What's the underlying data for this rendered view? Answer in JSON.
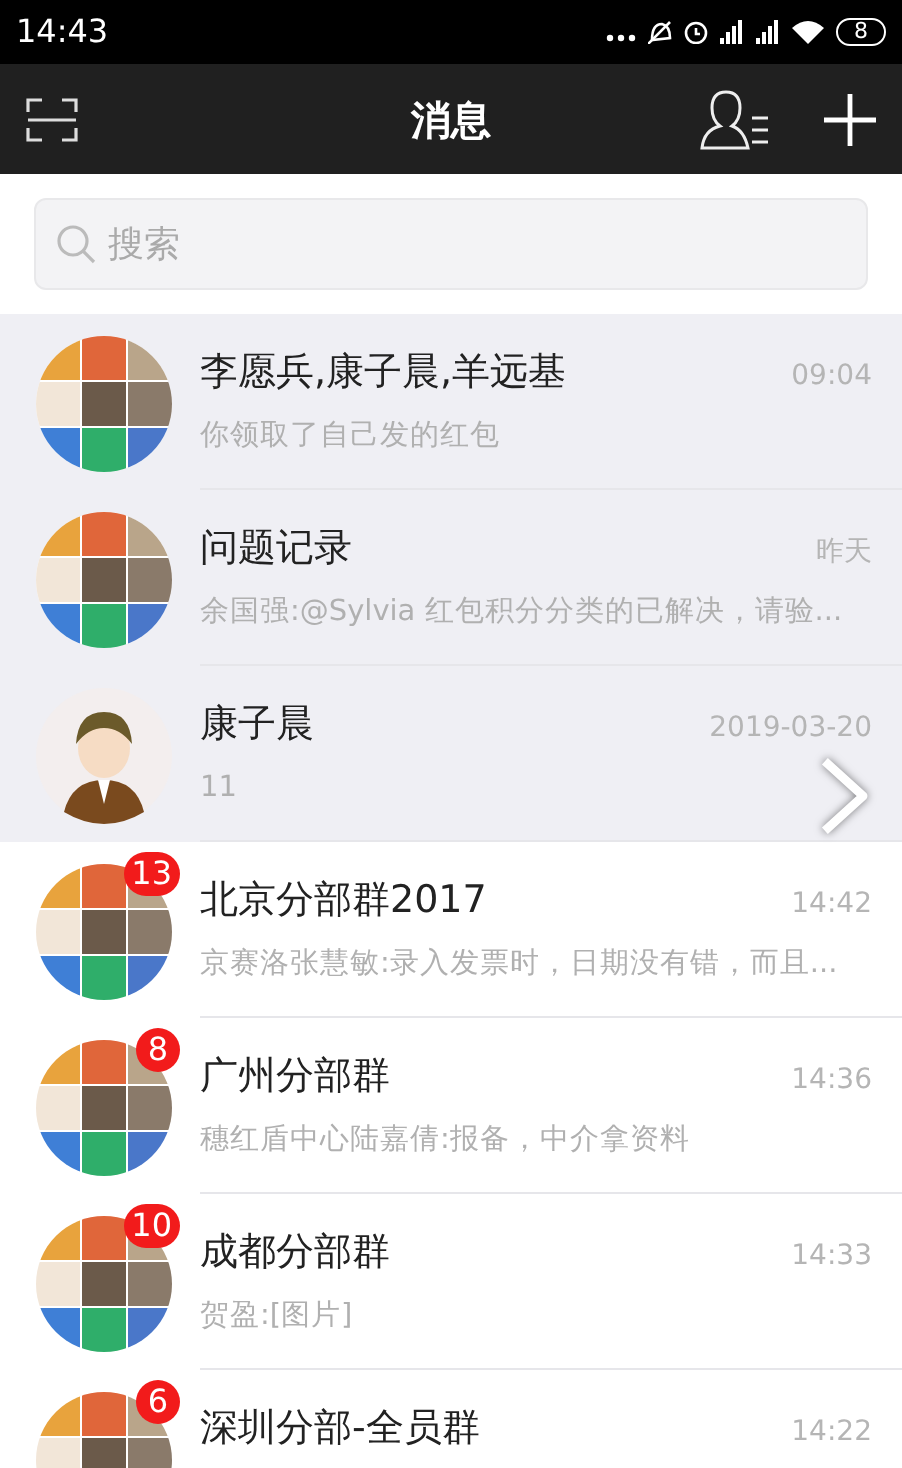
{
  "status_bar": {
    "time": "14:43",
    "battery": "8"
  },
  "nav": {
    "title": "消息"
  },
  "search": {
    "placeholder": "搜索"
  },
  "chats": [
    {
      "kind": "group",
      "name": "李愿兵,康子晨,羊远基",
      "time": "09:04",
      "preview": "你领取了自己发的红包",
      "pinned": true
    },
    {
      "kind": "group",
      "name": "问题记录",
      "time": "昨天",
      "preview": "余国强:@Sylvia 红包积分分类的已解决，请验...",
      "pinned": true
    },
    {
      "kind": "single",
      "name": "康子晨",
      "time": "2019-03-20",
      "preview": "11",
      "pinned": true
    },
    {
      "kind": "group",
      "name": "北京分部群2017",
      "time": "14:42",
      "preview": "京赛洛张慧敏:录入发票时，日期没有错，而且...",
      "pinned": false,
      "badge": "13"
    },
    {
      "kind": "group",
      "name": "广州分部群",
      "time": "14:36",
      "preview": "穗红盾中心陆嘉倩:报备，中介拿资料",
      "pinned": false,
      "badge": "8"
    },
    {
      "kind": "group",
      "name": "成都分部群",
      "time": "14:33",
      "preview": "贺盈:[图片]",
      "pinned": false,
      "badge": "10"
    },
    {
      "kind": "group",
      "name": "深圳分部-全员群",
      "time": "14:22",
      "pinned": false,
      "badge": "6"
    }
  ]
}
